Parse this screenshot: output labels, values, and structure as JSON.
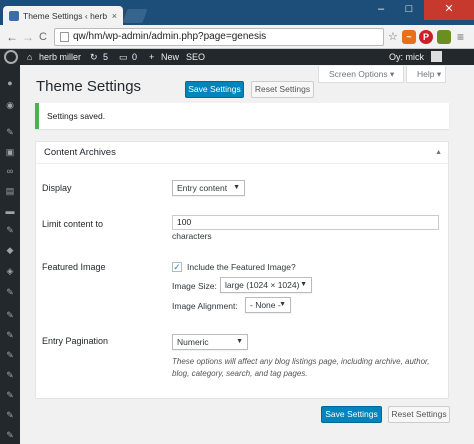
{
  "browser": {
    "tab_title": "Theme Settings ‹ herb miller",
    "tab_close": "×",
    "window_minimize": "–",
    "window_maximize": "□",
    "window_close": "✕",
    "back": "←",
    "forward": "→",
    "reload": "C",
    "url": "qw/hm/wp-admin/admin.php?page=genesis",
    "bookmark_star": "☆",
    "menu_glyph": "≡"
  },
  "adminbar": {
    "site_name": "herb miller",
    "updates_count": "5",
    "comments_count": "0",
    "new_label": "New",
    "seo_label": "SEO",
    "greeting": "Oy: mick"
  },
  "header": {
    "title": "Theme Settings",
    "save_label": "Save Settings",
    "reset_label": "Reset Settings",
    "screen_options_label": "Screen Options ▾",
    "help_label": "Help ▾"
  },
  "notice": {
    "message": "Settings saved."
  },
  "box": {
    "title": "Content Archives",
    "toggle": "▲",
    "display_label": "Display",
    "display_value": "Entry content",
    "limit_label": "Limit content to",
    "limit_value": "100",
    "limit_unit": "characters",
    "featured_label": "Featured Image",
    "include_image_label": "Include the Featured Image?",
    "include_image_checked": true,
    "image_size_label": "Image Size:",
    "image_size_value": "large (1024 × 1024)",
    "image_align_label": "Image Alignment:",
    "image_align_value": "- None -",
    "pagination_label": "Entry Pagination",
    "pagination_value": "Numeric",
    "pagination_description": "These options will affect any blog listings page, including archive, author, blog, category, search, and tag pages."
  },
  "footer": {
    "save_label": "Save Settings",
    "reset_label": "Reset Settings"
  },
  "colors": {
    "primary_button": "#0085ba",
    "notice_success": "#46b450",
    "adminbar_bg": "#23282d"
  }
}
